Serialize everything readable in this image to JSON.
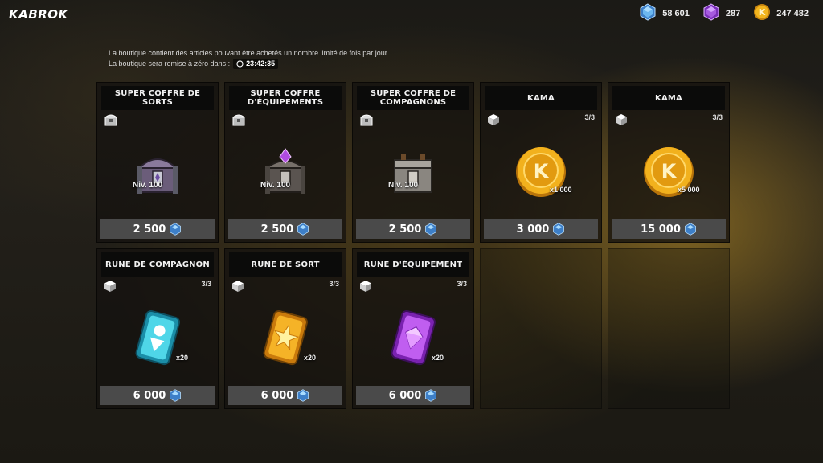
{
  "header": {
    "title": "KABROK"
  },
  "currencies": [
    {
      "icon": "blue-gem-icon",
      "value": "58 601"
    },
    {
      "icon": "purple-gem-icon",
      "value": "287"
    },
    {
      "icon": "kama-coin-icon",
      "value": "247 482"
    }
  ],
  "info": {
    "line1": "La boutique contient des articles pouvant être achetés un nombre limité de fois par jour.",
    "line2": "La boutique sera remise à zéro dans :",
    "timer": "23:42:35"
  },
  "cards": [
    {
      "title": "SUPER COFFRE DE SORTS",
      "level": "Niv. 100",
      "price": "2 500",
      "icon": "spell-chest-icon"
    },
    {
      "title": "SUPER COFFRE D'ÉQUIPEMENTS",
      "level": "Niv. 100",
      "price": "2 500",
      "icon": "equipment-chest-icon"
    },
    {
      "title": "SUPER COFFRE DE COMPAGNONS",
      "level": "Niv. 100",
      "price": "2 500",
      "icon": "companion-chest-icon"
    },
    {
      "title": "KAMA",
      "count": "3/3",
      "multiplier": "x1 000",
      "price": "3 000",
      "icon": "kama-coin-icon"
    },
    {
      "title": "KAMA",
      "count": "3/3",
      "multiplier": "x5 000",
      "price": "15 000",
      "icon": "kama-coin-icon"
    },
    {
      "title": "RUNE DE COMPAGNON",
      "count": "3/3",
      "multiplier": "x20",
      "price": "6 000",
      "icon": "companion-rune-icon"
    },
    {
      "title": "RUNE DE SORT",
      "count": "3/3",
      "multiplier": "x20",
      "price": "6 000",
      "icon": "spell-rune-icon"
    },
    {
      "title": "RUNE D'ÉQUIPEMENT",
      "count": "3/3",
      "multiplier": "x20",
      "price": "6 000",
      "icon": "equipment-rune-icon"
    }
  ],
  "colors": {
    "gem_blue": "#5aa8e8",
    "gem_purple": "#9a4ad8",
    "coin_gold": "#e6a51a",
    "price_bg": "#4a4a4a",
    "header_bg": "#0b0b0a"
  }
}
